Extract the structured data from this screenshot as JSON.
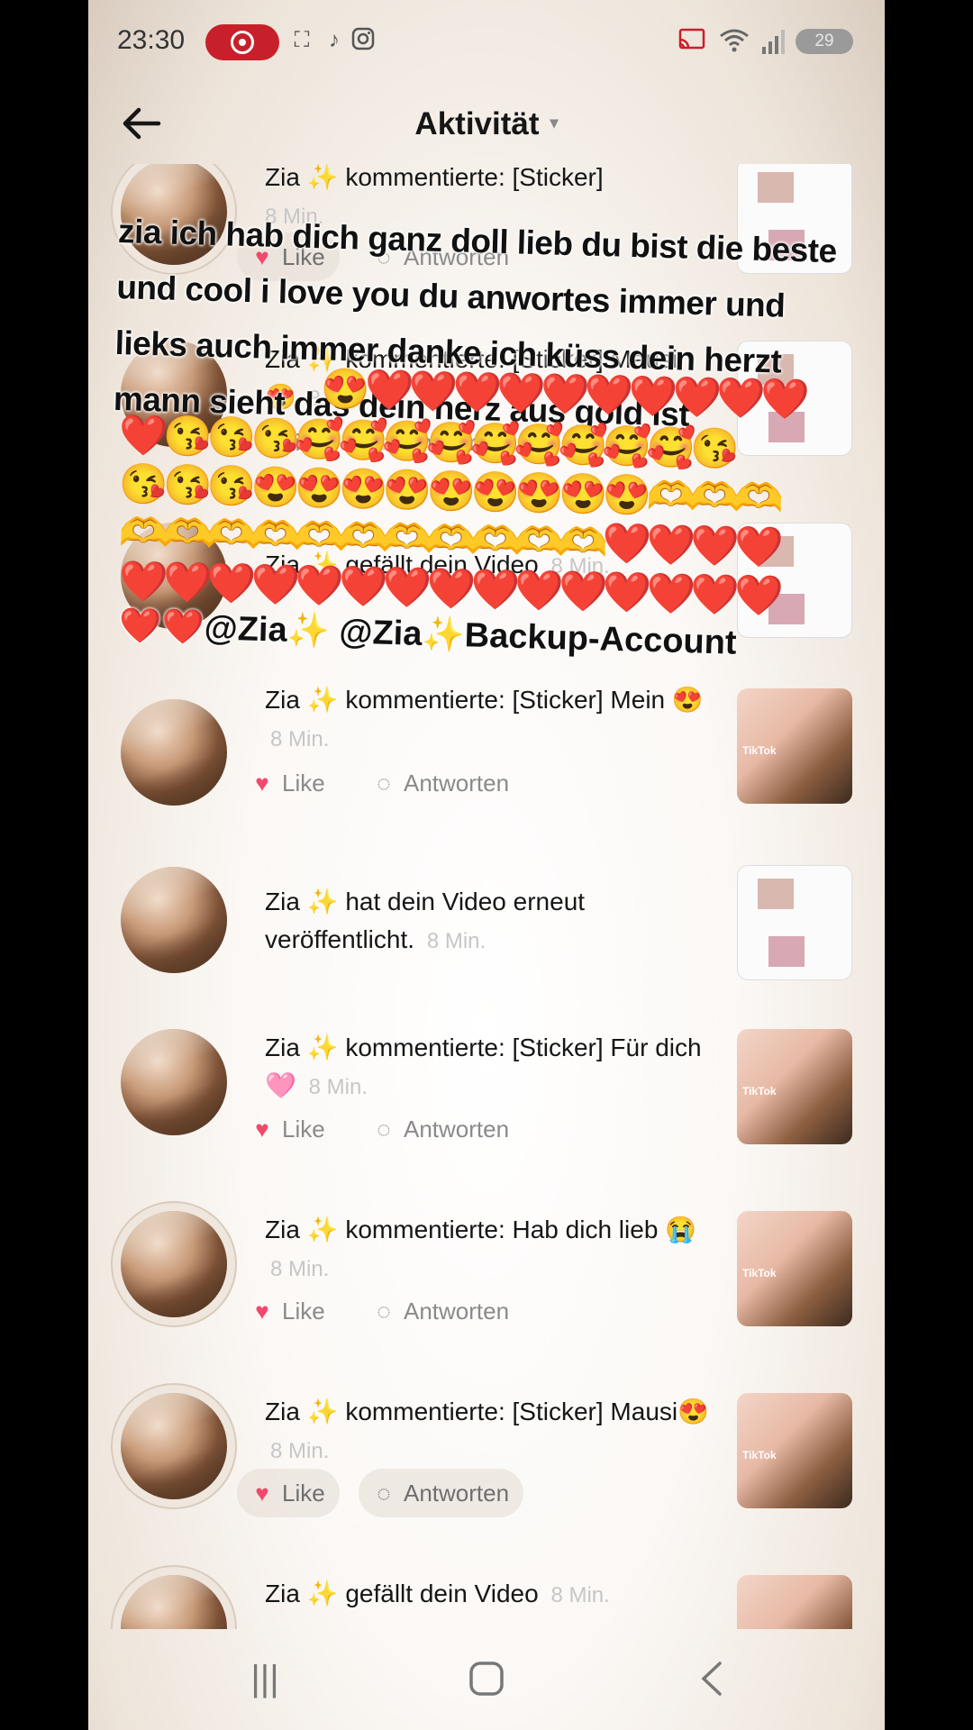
{
  "status_bar": {
    "time": "23:30",
    "battery": "29",
    "network": "6",
    "icons": [
      "screen-record-icon",
      "screenshot-icon",
      "tiktok-icon",
      "instagram-icon",
      "cast-icon",
      "wifi-icon",
      "signal-icon",
      "battery-icon"
    ]
  },
  "header": {
    "title": "Aktivität",
    "caret": "▾"
  },
  "overlay_sticker": {
    "text": "zia ich hab dich ganz doll lieb du bist die beste und cool i love you du anwortes immer und lieks auch immer danke ich küss dein herzt mann sieht das dein herz aus gold ist",
    "emoji_row_1": "😍❤️❤️❤️❤️❤️❤️❤️❤️❤️❤️",
    "emoji_row_2": "❤️😘😘😘🥰🥰🥰🥰🥰🥰🥰🥰🥰😘",
    "emoji_row_3": "😘😘😘😍😍😍😍😍😍😍😍😍🫶🫶🫶",
    "emoji_row_4": "🫶🫶🫶🫶🫶🫶🫶🫶🫶🫶🫶❤️❤️❤️❤️",
    "emoji_row_5": "❤️❤️❤️❤️❤️❤️❤️❤️❤️❤️❤️❤️❤️❤️❤️",
    "mentions": "❤️❤️@Zia✨ @Zia✨Backup-Account"
  },
  "notifications": [
    {
      "name": "Zia",
      "sparkle": "✨",
      "action": "kommentierte: [Sticker]",
      "time": "8 Min.",
      "like": "Like",
      "reply": "Antworten"
    },
    {
      "name": "Zia",
      "sparkle": "✨",
      "action": "kommentierte: [Sticker] Mausi 😍",
      "time": "8 Min.",
      "like": "Like",
      "reply": "Antworten"
    },
    {
      "name": "Zia",
      "sparkle": "✨",
      "action": "gefällt dein Video",
      "time": "8 Min."
    },
    {
      "name": "Zia",
      "sparkle": "✨",
      "action": "kommentierte: [Sticker] Mein 😍",
      "time": "8 Min.",
      "like": "Like",
      "reply": "Antworten"
    },
    {
      "name": "Zia",
      "sparkle": "✨",
      "action": "hat dein Video erneut veröffentlicht.",
      "time": "8 Min."
    },
    {
      "name": "Zia",
      "sparkle": "✨",
      "action": "kommentierte: [Sticker] Für dich 🩷",
      "time": "8 Min.",
      "like": "Like",
      "reply": "Antworten"
    },
    {
      "name": "Zia",
      "sparkle": "✨",
      "action": "kommentierte: Hab dich lieb 😭",
      "time": "8 Min.",
      "like": "Like",
      "reply": "Antworten"
    },
    {
      "name": "Zia",
      "sparkle": "✨",
      "action": "kommentierte: [Sticker] Mausi😍",
      "time": "8 Min.",
      "like": "Like",
      "reply": "Antworten"
    },
    {
      "name": "Zia",
      "sparkle": "✨",
      "action": "gefällt dein Video",
      "time": "8 Min."
    }
  ],
  "nav": {
    "recents": "|||",
    "home": "○",
    "back": "<"
  },
  "colors": {
    "heart": "#f2486c",
    "record": "#c8202a",
    "text": "#161616",
    "muted": "#c6c6c6"
  }
}
